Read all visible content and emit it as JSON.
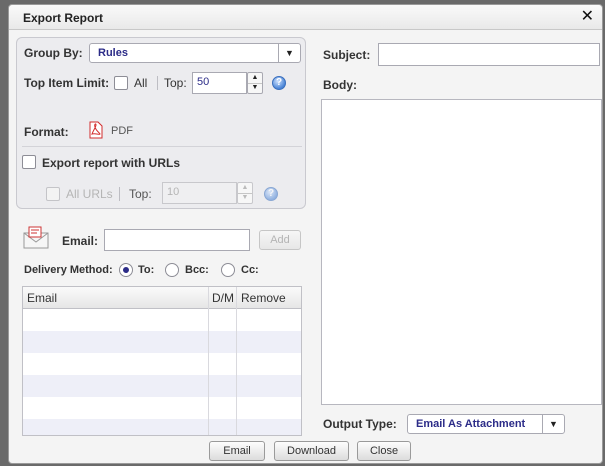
{
  "dialog": {
    "title": "Export Report",
    "close_glyph": "✕"
  },
  "group_by": {
    "label": "Group By:",
    "value": "Rules"
  },
  "top_item_limit": {
    "label": "Top Item Limit:",
    "all_label": "All",
    "top_label": "Top:",
    "top_value": "50"
  },
  "format": {
    "label": "Format:",
    "value": "PDF",
    "icon": "pdf-icon"
  },
  "export_urls": {
    "label": "Export report with URLs",
    "all_urls_label": "All URLs",
    "top_label": "Top:",
    "top_value": "10"
  },
  "email_section": {
    "label": "Email:",
    "value": "",
    "add_label": "Add",
    "icon": "mail-icon"
  },
  "delivery": {
    "label": "Delivery Method:",
    "to_label": "To:",
    "bcc_label": "Bcc:",
    "cc_label": "Cc:",
    "selected": "To"
  },
  "table": {
    "columns": [
      "Email",
      "D/M",
      "Remove"
    ],
    "rows": [
      [
        "",
        "",
        ""
      ],
      [
        "",
        "",
        ""
      ],
      [
        "",
        "",
        ""
      ],
      [
        "",
        "",
        ""
      ],
      [
        "",
        "",
        ""
      ]
    ]
  },
  "right": {
    "subject_label": "Subject:",
    "subject_value": "",
    "body_label": "Body:",
    "body_value": "",
    "output_type_label": "Output Type:",
    "output_type_value": "Email As Attachment"
  },
  "footer": {
    "email_button": "Email",
    "download_button": "Download",
    "close_button": "Close"
  },
  "colors": {
    "accent": "#2c2c88",
    "help_blue": "#4a84d6",
    "pdf_red": "#d22c2c"
  }
}
